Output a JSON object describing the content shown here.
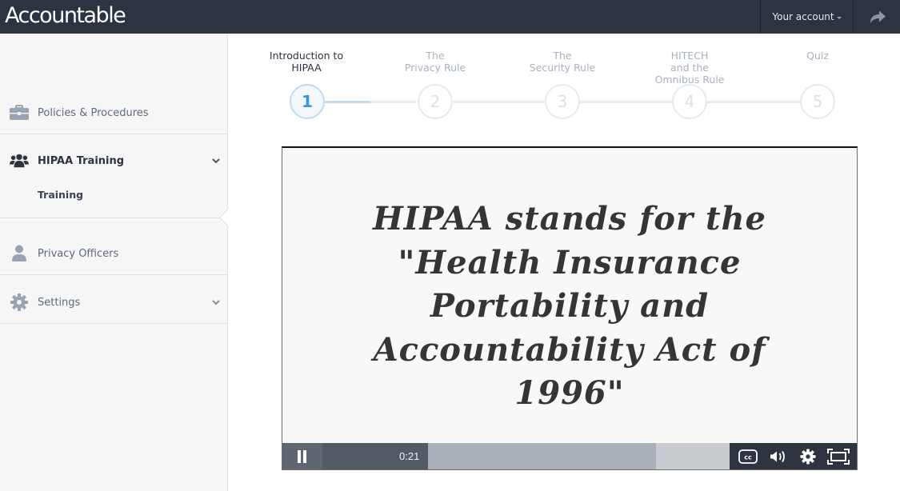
{
  "app": {
    "logo": "Accountable",
    "account_label": "Your account",
    "share_icon": "share-arrow-icon"
  },
  "sidebar": {
    "items": [
      {
        "label": "Policies & Procedures",
        "icon": "briefcase-icon",
        "active": false,
        "expandable": false
      },
      {
        "label": "HIPAA Training",
        "icon": "users-icon",
        "active": true,
        "expandable": true,
        "children": [
          {
            "label": "Training"
          }
        ]
      },
      {
        "label": "Privacy Officers",
        "icon": "user-icon",
        "active": false,
        "expandable": false
      },
      {
        "label": "Settings",
        "icon": "gear-icon",
        "active": false,
        "expandable": true
      }
    ]
  },
  "stepper": {
    "current": 1,
    "steps": [
      {
        "number": "1",
        "label": "Introduction to\nHIPAA"
      },
      {
        "number": "2",
        "label": "The\nPrivacy Rule"
      },
      {
        "number": "3",
        "label": "The\nSecurity Rule"
      },
      {
        "number": "4",
        "label": "HITECH\nand the\nOmnibus Rule"
      },
      {
        "number": "5",
        "label": "Quiz"
      }
    ]
  },
  "video": {
    "slide_lines": [
      "HIPAA stands for the",
      "\"Health Insurance",
      "Portability and",
      "Accountability Act of",
      "1996\""
    ],
    "current_time": "0:21",
    "played_fraction": 0.26,
    "buffered_fraction": 0.82,
    "state": "playing",
    "controls": [
      "pause-icon",
      "closed-captions-icon",
      "volume-icon",
      "settings-gear-icon",
      "fullscreen-icon"
    ]
  },
  "colors": {
    "topbar": "#2c3341",
    "accent": "#3a93de",
    "sidebar_bg": "#f6f6f6"
  }
}
